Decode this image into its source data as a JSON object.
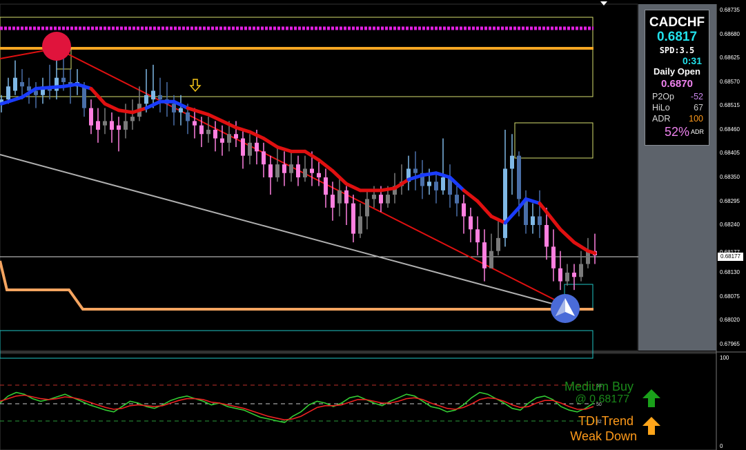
{
  "symbol": "CADCHF",
  "info_panel": {
    "price": "0.6817",
    "spread": "SPD:3.5",
    "timer": "0:31",
    "daily_open_label": "Daily Open",
    "daily_open": "0.6870",
    "rows": [
      {
        "label": "P2Op",
        "value": "-52",
        "color": "#cc88ee"
      },
      {
        "label": "HiLo",
        "value": "67",
        "color": "#cccccc"
      },
      {
        "label": "ADR",
        "value": "100",
        "color": "#ff9a1a"
      }
    ],
    "adr_pct": "52%",
    "adr_tag": "ADR"
  },
  "chart_data": [
    {
      "type": "candlestick",
      "symbol": "CADCHF",
      "y_ticks": [
        "0.68735",
        "0.68680",
        "0.68625",
        "0.68570",
        "0.68515",
        "0.68460",
        "0.68405",
        "0.68350",
        "0.68295",
        "0.68240",
        "0.68177",
        "0.68130",
        "0.68075",
        "0.68020",
        "0.67965"
      ],
      "ylim": [
        0.6795,
        0.6875
      ],
      "current_price_tag": "0.68177",
      "moving_average": [
        [
          0,
          0.6852
        ],
        [
          6,
          0.68535
        ],
        [
          10,
          0.68555
        ],
        [
          18,
          0.6856
        ],
        [
          22,
          0.68565
        ],
        [
          26,
          0.68555
        ],
        [
          30,
          0.6852
        ],
        [
          34,
          0.68505
        ],
        [
          38,
          0.685
        ],
        [
          42,
          0.6851
        ],
        [
          46,
          0.68525
        ],
        [
          50,
          0.68525
        ],
        [
          54,
          0.6851
        ],
        [
          60,
          0.68495
        ],
        [
          64,
          0.6848
        ],
        [
          68,
          0.68465
        ],
        [
          72,
          0.68455
        ],
        [
          76,
          0.6844
        ],
        [
          80,
          0.6842
        ],
        [
          84,
          0.6841
        ],
        [
          88,
          0.6841
        ],
        [
          92,
          0.6839
        ],
        [
          96,
          0.68365
        ],
        [
          100,
          0.68335
        ],
        [
          104,
          0.6832
        ],
        [
          110,
          0.6832
        ],
        [
          114,
          0.68325
        ],
        [
          118,
          0.68345
        ],
        [
          122,
          0.68355
        ],
        [
          126,
          0.6836
        ],
        [
          130,
          0.6835
        ],
        [
          134,
          0.6832
        ],
        [
          138,
          0.68295
        ],
        [
          142,
          0.6826
        ],
        [
          146,
          0.68245
        ],
        [
          150,
          0.6828
        ],
        [
          152,
          0.683
        ],
        [
          156,
          0.6829
        ],
        [
          158,
          0.6827
        ],
        [
          162,
          0.6823
        ],
        [
          166,
          0.682
        ],
        [
          170,
          0.6818
        ],
        [
          172,
          0.68175
        ]
      ],
      "ma_blue_ranges": [
        [
          0,
          24
        ],
        [
          42,
          54
        ],
        [
          118,
          132
        ],
        [
          146,
          156
        ]
      ],
      "candles": [
        [
          0,
          0.6852,
          0.6853,
          0.6854,
          0.685
        ],
        [
          2,
          0.6853,
          0.6856,
          0.6858,
          0.6852
        ],
        [
          4,
          0.6855,
          0.6858,
          0.6862,
          0.6854
        ],
        [
          6,
          0.6857,
          0.6856,
          0.686,
          0.6853
        ],
        [
          8,
          0.6856,
          0.6855,
          0.6858,
          0.6852
        ],
        [
          10,
          0.6855,
          0.6854,
          0.6857,
          0.6851
        ],
        [
          12,
          0.6854,
          0.6856,
          0.6858,
          0.6852
        ],
        [
          14,
          0.6856,
          0.6855,
          0.6861,
          0.6853
        ],
        [
          16,
          0.6855,
          0.6858,
          0.6866,
          0.6853
        ],
        [
          18,
          0.6858,
          0.6857,
          0.6863,
          0.6855
        ],
        [
          20,
          0.6857,
          0.6856,
          0.686,
          0.6852
        ],
        [
          22,
          0.6856,
          0.6857,
          0.686,
          0.6854
        ],
        [
          24,
          0.6856,
          0.6851,
          0.6857,
          0.6849
        ],
        [
          26,
          0.6851,
          0.6847,
          0.6853,
          0.6845
        ],
        [
          28,
          0.6848,
          0.6846,
          0.6851,
          0.6843
        ],
        [
          30,
          0.6847,
          0.6848,
          0.6851,
          0.6845
        ],
        [
          32,
          0.6848,
          0.6846,
          0.685,
          0.6843
        ],
        [
          34,
          0.6847,
          0.6846,
          0.6849,
          0.6841
        ],
        [
          36,
          0.6846,
          0.6848,
          0.6852,
          0.6844
        ],
        [
          38,
          0.6848,
          0.6849,
          0.6853,
          0.6846
        ],
        [
          40,
          0.6849,
          0.6852,
          0.6856,
          0.6848
        ],
        [
          42,
          0.6852,
          0.6854,
          0.686,
          0.685
        ],
        [
          44,
          0.6853,
          0.6855,
          0.6861,
          0.6851
        ],
        [
          46,
          0.6854,
          0.6853,
          0.6858,
          0.685
        ],
        [
          48,
          0.6853,
          0.6852,
          0.6857,
          0.6849
        ],
        [
          50,
          0.6852,
          0.685,
          0.6854,
          0.6847
        ],
        [
          52,
          0.685,
          0.6851,
          0.6854,
          0.6847
        ],
        [
          54,
          0.685,
          0.6848,
          0.6852,
          0.6845
        ],
        [
          56,
          0.6848,
          0.6847,
          0.6851,
          0.6844
        ],
        [
          58,
          0.6847,
          0.6845,
          0.6849,
          0.6842
        ],
        [
          60,
          0.6845,
          0.6846,
          0.6849,
          0.6843
        ],
        [
          62,
          0.6846,
          0.6844,
          0.6848,
          0.6841
        ],
        [
          64,
          0.6844,
          0.6843,
          0.6847,
          0.684
        ],
        [
          66,
          0.6843,
          0.6845,
          0.6848,
          0.6841
        ],
        [
          68,
          0.6845,
          0.6844,
          0.6848,
          0.6842
        ],
        [
          70,
          0.6844,
          0.684,
          0.6846,
          0.6837
        ],
        [
          72,
          0.684,
          0.6843,
          0.6845,
          0.6838
        ],
        [
          74,
          0.6843,
          0.6841,
          0.6846,
          0.6838
        ],
        [
          76,
          0.6841,
          0.6838,
          0.6843,
          0.6835
        ],
        [
          78,
          0.6838,
          0.6835,
          0.684,
          0.6831
        ],
        [
          80,
          0.6835,
          0.6838,
          0.6842,
          0.6834
        ],
        [
          82,
          0.6838,
          0.6836,
          0.6841,
          0.6833
        ],
        [
          84,
          0.6836,
          0.6838,
          0.6841,
          0.6834
        ],
        [
          86,
          0.6838,
          0.6835,
          0.684,
          0.6833
        ],
        [
          88,
          0.6835,
          0.6837,
          0.684,
          0.6834
        ],
        [
          90,
          0.6837,
          0.6836,
          0.6841,
          0.6833
        ],
        [
          92,
          0.6836,
          0.6835,
          0.6839,
          0.6833
        ],
        [
          94,
          0.6835,
          0.6831,
          0.6837,
          0.6828
        ],
        [
          96,
          0.6831,
          0.6828,
          0.6834,
          0.6825
        ],
        [
          98,
          0.6829,
          0.6832,
          0.6835,
          0.6826
        ],
        [
          100,
          0.6832,
          0.6829,
          0.6833,
          0.6824
        ],
        [
          102,
          0.6829,
          0.6822,
          0.6831,
          0.682
        ],
        [
          104,
          0.6822,
          0.6826,
          0.6829,
          0.6821
        ],
        [
          106,
          0.6826,
          0.683,
          0.6832,
          0.6823
        ],
        [
          108,
          0.683,
          0.6831,
          0.6833,
          0.6828
        ],
        [
          110,
          0.6831,
          0.6829,
          0.6833,
          0.6827
        ],
        [
          112,
          0.6829,
          0.6831,
          0.6833,
          0.6828
        ],
        [
          114,
          0.6831,
          0.6833,
          0.6836,
          0.6829
        ],
        [
          116,
          0.6833,
          0.6834,
          0.6838,
          0.6831
        ],
        [
          118,
          0.6834,
          0.6837,
          0.684,
          0.6832
        ],
        [
          120,
          0.6837,
          0.6836,
          0.6841,
          0.6832
        ],
        [
          122,
          0.6836,
          0.6833,
          0.6839,
          0.683
        ],
        [
          124,
          0.6833,
          0.6834,
          0.6837,
          0.6831
        ],
        [
          126,
          0.6834,
          0.6832,
          0.6836,
          0.6829
        ],
        [
          128,
          0.6832,
          0.6835,
          0.6844,
          0.6831
        ],
        [
          130,
          0.6835,
          0.6831,
          0.6838,
          0.6828
        ],
        [
          132,
          0.6831,
          0.6829,
          0.6833,
          0.6826
        ],
        [
          134,
          0.6829,
          0.6826,
          0.6831,
          0.6822
        ],
        [
          136,
          0.6826,
          0.6823,
          0.6828,
          0.682
        ],
        [
          138,
          0.6823,
          0.682,
          0.6826,
          0.6817
        ],
        [
          140,
          0.682,
          0.6814,
          0.6823,
          0.6811
        ],
        [
          142,
          0.6814,
          0.6818,
          0.6822,
          0.6814
        ],
        [
          144,
          0.6818,
          0.6821,
          0.6825,
          0.6817
        ],
        [
          146,
          0.6821,
          0.6837,
          0.6846,
          0.6819
        ],
        [
          148,
          0.6837,
          0.684,
          0.6845,
          0.6831
        ],
        [
          150,
          0.684,
          0.683,
          0.6841,
          0.6826
        ],
        [
          152,
          0.683,
          0.6824,
          0.6832,
          0.6822
        ],
        [
          154,
          0.6824,
          0.6826,
          0.6829,
          0.6822
        ],
        [
          156,
          0.6826,
          0.6824,
          0.6832,
          0.6821
        ],
        [
          158,
          0.6824,
          0.6819,
          0.6828,
          0.6816
        ],
        [
          160,
          0.6819,
          0.6814,
          0.6823,
          0.6811
        ],
        [
          162,
          0.6814,
          0.6811,
          0.6818,
          0.6809
        ],
        [
          164,
          0.6811,
          0.6813,
          0.6815,
          0.681
        ],
        [
          166,
          0.6813,
          0.6812,
          0.6815,
          0.6809
        ],
        [
          168,
          0.6812,
          0.6815,
          0.6818,
          0.6811
        ],
        [
          170,
          0.6815,
          0.6818,
          0.6821,
          0.6814
        ],
        [
          172,
          0.6818,
          0.6817,
          0.6822,
          0.6815
        ]
      ]
    },
    {
      "type": "line",
      "name": "TDI",
      "y_ticks": [
        "100",
        "0"
      ],
      "levels": [
        "68",
        "50",
        "32"
      ],
      "ylim": [
        0,
        100
      ],
      "series": [
        {
          "color": "#33cc33",
          "values": [
            50,
            58,
            62,
            60,
            55,
            52,
            54,
            57,
            60,
            56,
            52,
            48,
            45,
            42,
            40,
            46,
            52,
            50,
            46,
            44,
            48,
            53,
            56,
            58,
            55,
            52,
            48,
            50,
            46,
            44,
            42,
            38,
            34,
            32,
            30,
            28,
            35,
            40,
            48,
            52,
            50,
            46,
            50,
            56,
            58,
            54,
            50,
            47,
            52,
            56,
            60,
            58,
            52,
            46,
            44,
            40,
            42,
            48,
            56,
            62,
            60,
            55,
            50,
            44,
            42,
            50,
            56,
            58,
            54,
            46,
            42,
            40,
            44,
            50
          ]
        },
        {
          "color": "#ee2222",
          "values": [
            52,
            55,
            58,
            59,
            57,
            55,
            54,
            55,
            57,
            56,
            54,
            51,
            48,
            45,
            43,
            44,
            47,
            48,
            47,
            46,
            47,
            50,
            53,
            55,
            55,
            54,
            51,
            50,
            48,
            46,
            44,
            41,
            38,
            35,
            33,
            31,
            32,
            35,
            40,
            45,
            47,
            47,
            48,
            51,
            54,
            54,
            52,
            50,
            50,
            52,
            55,
            56,
            54,
            50,
            47,
            44,
            43,
            45,
            49,
            54,
            56,
            55,
            52,
            48,
            45,
            46,
            50,
            53,
            53,
            50,
            46,
            43,
            43,
            46
          ]
        }
      ]
    }
  ],
  "signals": {
    "medium_buy": "Medium Buy",
    "medium_buy_price": "@ 0.68177",
    "tdi_trend": "TDI Trend",
    "weak_down": "Weak Down"
  }
}
